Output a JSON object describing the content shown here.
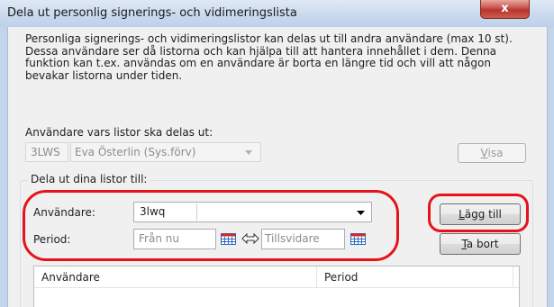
{
  "window": {
    "title": "Dela ut personlig signerings- och vidimeringslista",
    "close_glyph": "x"
  },
  "description": "Personliga signerings- och vidimeringslistor kan delas ut till andra användare (max 10 st). Dessa användare ser då listorna och kan hjälpa till att hantera innehållet i dem. Denna funktion kan t.ex. användas om en användare är borta en längre tid och vill att någon bevakar listorna under tiden.",
  "source_user": {
    "label": "Användare vars listor ska delas ut:",
    "code": "3LWS",
    "name": "Eva Österlin (Sys.förv)",
    "view_button_prefix": "",
    "view_button_mnemonic": "V",
    "view_button_rest": "isa"
  },
  "share_group": {
    "title": "Dela ut dina listor till:",
    "user_label": "Användare:",
    "user_value": "3lwq",
    "period_label": "Period:",
    "from_placeholder": "Från nu",
    "to_placeholder": "Tillsvidare",
    "add_button_prefix": "",
    "add_button_mnemonic": "L",
    "add_button_rest": "ägg till",
    "remove_button_prefix": "",
    "remove_button_mnemonic": "T",
    "remove_button_rest": "a bort"
  },
  "table": {
    "columns": [
      "Användare",
      "Period"
    ]
  },
  "icons": {
    "calendar": "calendar-icon",
    "swap": "double-arrow-icon",
    "dropdown": "chevron-down-icon",
    "close": "close-icon"
  },
  "colors": {
    "annotation_red": "#e5141b",
    "close_red": "#c75050",
    "calendar_red": "#d0282e",
    "calendar_blue": "#2d6cc0"
  }
}
